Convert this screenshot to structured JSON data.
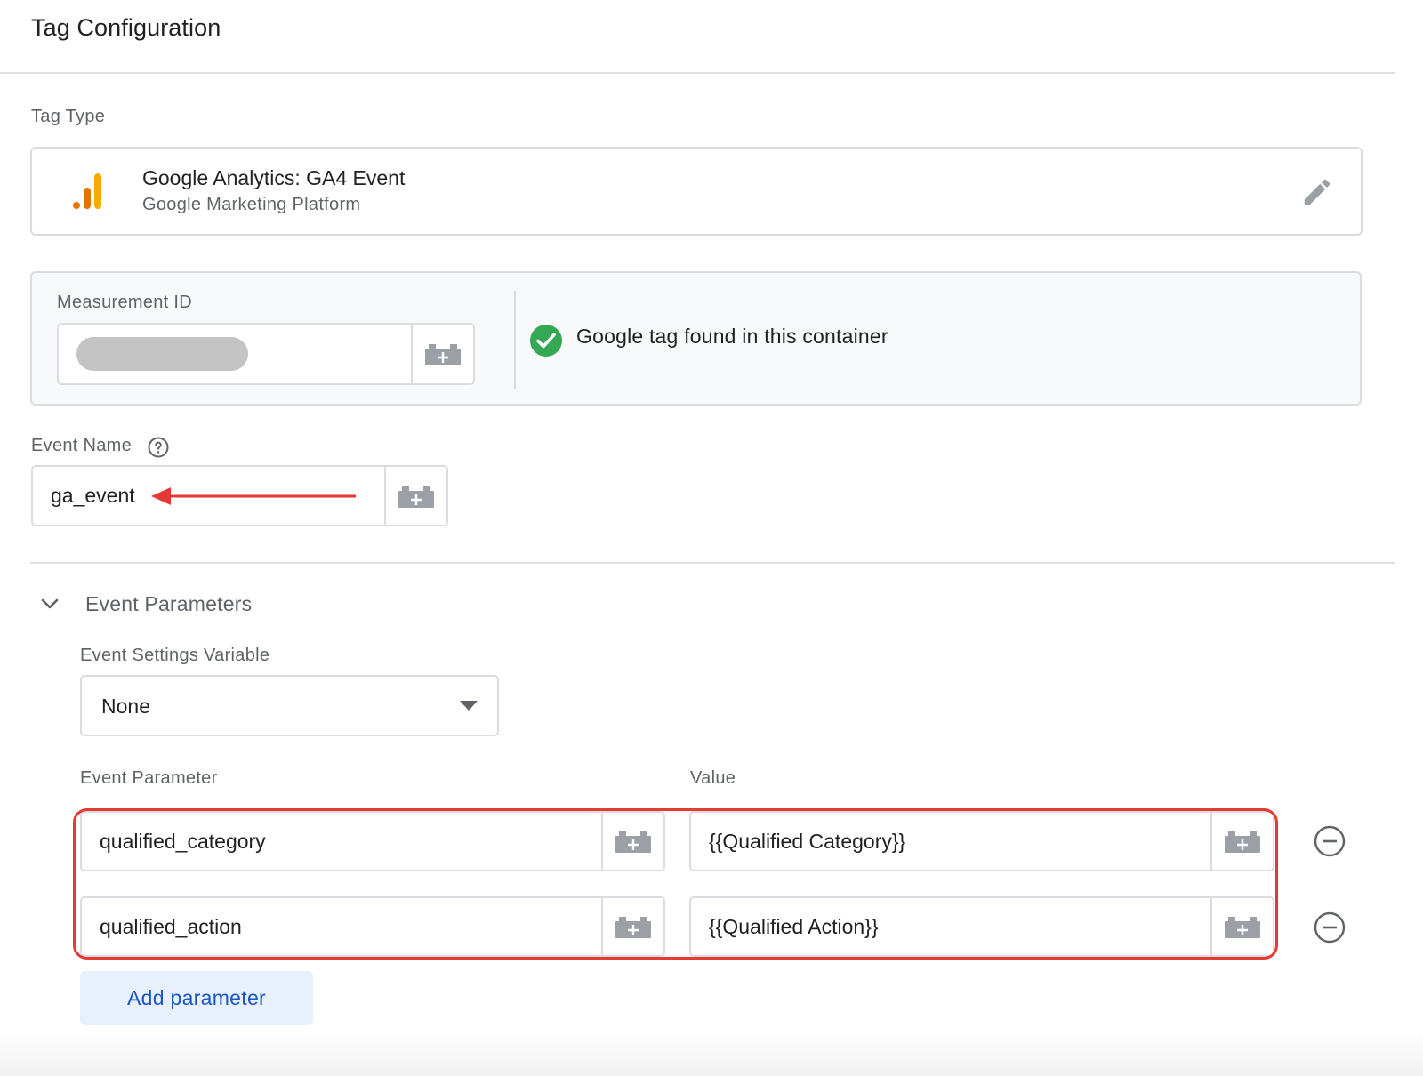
{
  "header": {
    "title": "Tag Configuration"
  },
  "tag_type": {
    "label": "Tag Type",
    "name": "Google Analytics: GA4 Event",
    "platform": "Google Marketing Platform"
  },
  "measurement": {
    "label": "Measurement ID",
    "status_text": "Google tag found in this container",
    "status_color": "#34a853"
  },
  "event_name": {
    "label": "Event Name",
    "value": "ga_event"
  },
  "event_parameters": {
    "section_title": "Event Parameters",
    "settings_variable_label": "Event Settings Variable",
    "settings_variable_value": "None",
    "param_column_label": "Event Parameter",
    "value_column_label": "Value",
    "rows": [
      {
        "parameter": "qualified_category",
        "value": "{{Qualified Category}}"
      },
      {
        "parameter": "qualified_action",
        "value": "{{Qualified Action}}"
      }
    ],
    "add_button_label": "Add parameter"
  },
  "colors": {
    "accent": "#1a56c4",
    "annotation_red": "#e53935",
    "ga_orange": "#f9ab00",
    "ga_orange_dark": "#e37400"
  }
}
